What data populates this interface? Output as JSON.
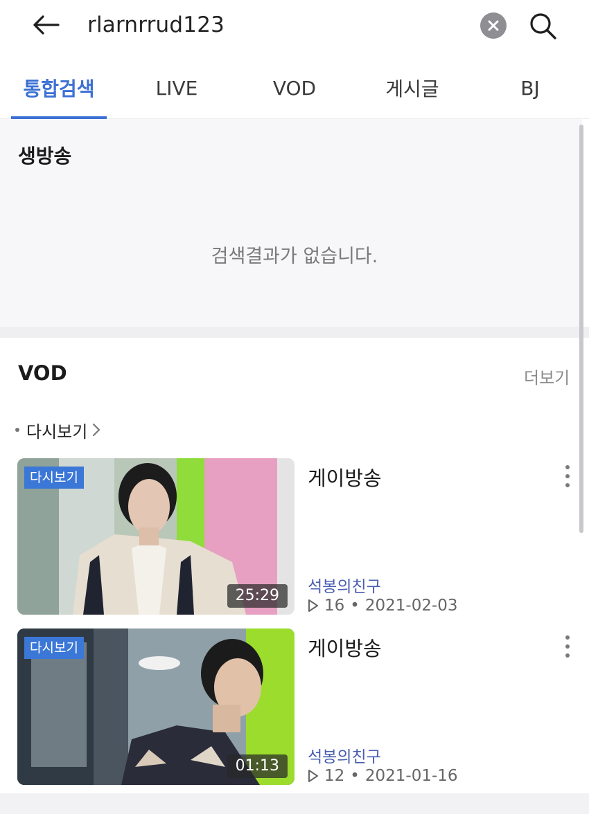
{
  "search": {
    "query": "rlarnrrud123"
  },
  "tabs": [
    {
      "label": "통합검색",
      "active": true
    },
    {
      "label": "LIVE"
    },
    {
      "label": "VOD"
    },
    {
      "label": "게시글"
    },
    {
      "label": "BJ"
    }
  ],
  "live": {
    "title": "생방송",
    "empty_message": "검색결과가 없습니다."
  },
  "vod": {
    "title": "VOD",
    "more_label": "더보기",
    "filter_label": "다시보기",
    "items": [
      {
        "badge": "다시보기",
        "duration": "25:29",
        "title": "게이방송",
        "author": "석봉의친구",
        "views": "16",
        "date": "2021-02-03"
      },
      {
        "badge": "다시보기",
        "duration": "01:13",
        "title": "게이방송",
        "author": "석봉의친구",
        "views": "12",
        "date": "2021-01-16"
      }
    ]
  },
  "colors": {
    "accent": "#3c71d4",
    "badge": "#3b77d6",
    "author": "#4a5db0"
  },
  "icons": [
    "back-arrow-icon",
    "clear-icon",
    "search-icon",
    "chevron-right-icon",
    "more-vertical-icon",
    "play-icon"
  ]
}
